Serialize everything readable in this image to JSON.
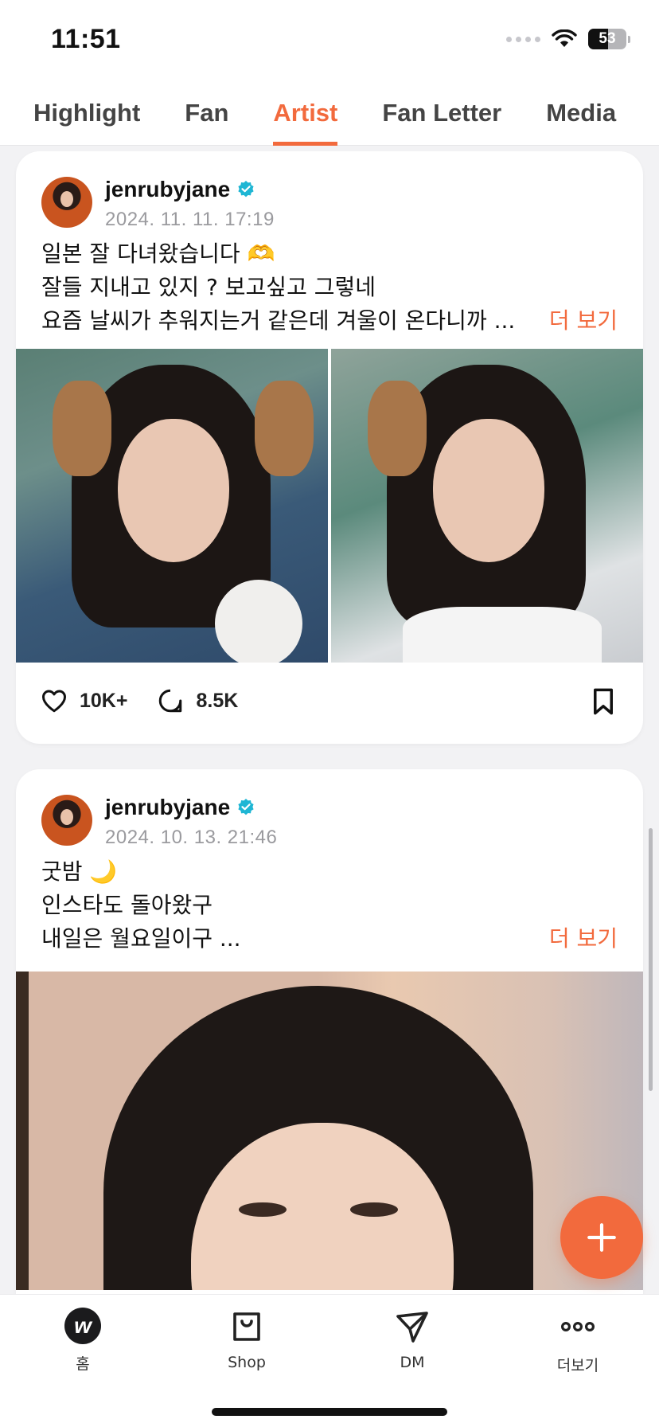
{
  "status_bar": {
    "time": "11:51",
    "battery": "53",
    "battery_level_percent": 53
  },
  "tabs": [
    {
      "label": "Highlight",
      "active": false
    },
    {
      "label": "Fan",
      "active": false
    },
    {
      "label": "Artist",
      "active": true
    },
    {
      "label": "Fan Letter",
      "active": false
    },
    {
      "label": "Media",
      "active": false
    }
  ],
  "posts": [
    {
      "username": "jenrubyjane",
      "timestamp": "2024. 11. 11. 17:19",
      "lines": [
        "일본 잘 다녀왔습니다 🫶",
        "잘들 지내고 있지 ? 보고싶고 그렇네",
        "요즘 날씨가 추워지는거 같은데 겨울이 온다니까 ..."
      ],
      "more": "더 보기",
      "likes": "10K+",
      "comments": "8.5K"
    },
    {
      "username": "jenrubyjane",
      "timestamp": "2024. 10. 13. 21:46",
      "lines": [
        "굿밤 🌙",
        "인스타도 돌아왔구",
        "내일은 월요일이구 ..."
      ],
      "more": "더 보기"
    }
  ],
  "bottom_nav": [
    {
      "label": "홈",
      "icon": "home-logo-icon"
    },
    {
      "label": "Shop",
      "icon": "shopping-bag-icon"
    },
    {
      "label": "DM",
      "icon": "paper-plane-icon"
    },
    {
      "label": "더보기",
      "icon": "more-dots-icon"
    }
  ],
  "colors": {
    "accent": "#f26a3d",
    "verified": "#1fb6d4"
  }
}
